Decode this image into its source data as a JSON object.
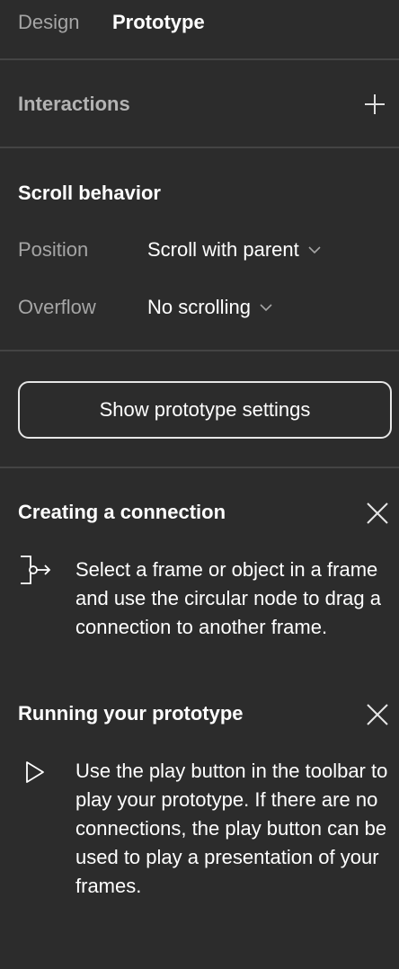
{
  "tabs": {
    "design": "Design",
    "prototype": "Prototype"
  },
  "interactions": {
    "title": "Interactions",
    "add_icon": "plus-icon"
  },
  "scroll_behavior": {
    "title": "Scroll behavior",
    "position_label": "Position",
    "position_value": "Scroll with parent",
    "overflow_label": "Overflow",
    "overflow_value": "No scrolling"
  },
  "settings": {
    "button_label": "Show prototype settings"
  },
  "help": {
    "connection": {
      "title": "Creating a connection",
      "icon": "connection-icon",
      "text": "Select a frame or object in a frame and use the circular node to drag a connection to another frame."
    },
    "running": {
      "title": "Running your prototype",
      "icon": "play-icon",
      "text": "Use the play button in the toolbar to play your prototype. If there are no connections, the play button can be used to play a presentation of your frames."
    }
  },
  "colors": {
    "background": "#2c2c2c",
    "divider": "#444444",
    "muted_text": "#a5a5a5",
    "text": "#ffffff"
  }
}
